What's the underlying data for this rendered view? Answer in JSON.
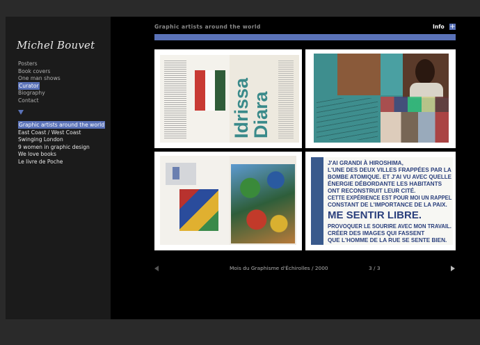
{
  "logo_text": "Michel Bouvet",
  "main_nav": [
    {
      "label": "Posters",
      "selected": false
    },
    {
      "label": "Book covers",
      "selected": false
    },
    {
      "label": "One man shows",
      "selected": false
    },
    {
      "label": "Curator",
      "selected": true
    },
    {
      "label": "Biography",
      "selected": false
    },
    {
      "label": "Contact",
      "selected": false
    }
  ],
  "sub_nav": [
    {
      "label": "Graphic artists around the world",
      "selected": true
    },
    {
      "label": "East Coast / West Coast",
      "selected": false
    },
    {
      "label": "Swinging London",
      "selected": false
    },
    {
      "label": "9 women in graphic design",
      "selected": false
    },
    {
      "label": "We love books",
      "selected": false
    },
    {
      "label": "Le livre de Poche",
      "selected": false
    }
  ],
  "header": {
    "title": "Graphic artists around the world",
    "info_label": "Info",
    "info_icon": "+"
  },
  "thumbnails": {
    "t1_title_line1": "Idrissa",
    "t1_title_line2": "Diara",
    "t4_lines": [
      "J'AI GRANDI À HIROSHIMA,",
      "L'UNE DES DEUX VILLES FRAPPÉES PAR LA",
      "BOMBE ATOMIQUE. ET J'AI VU AVEC QUELLE",
      "ÉNERGIE DÉBORDANTE LES HABITANTS",
      "ONT RECONSTRUIT LEUR CITÉ.",
      "CETTE EXPÉRIENCE EST POUR MOI UN RAPPEL",
      "CONSTANT DE L'IMPORTANCE DE LA PAIX.",
      "ME SENTIR LIBRE.",
      "PROVOQUER LE SOURIRE AVEC MON TRAVAIL.",
      "CRÉER DES IMAGES QUI FASSENT",
      "QUE L'HOMME DE LA RUE SE SENTE BIEN."
    ]
  },
  "footer": {
    "caption": "Mois du Graphisme d'Échirolles / 2000",
    "page_counter": "3 / 3"
  },
  "colors": {
    "accent": "#5a72b8",
    "sidebar_bg": "#1b1b1b",
    "main_bg": "#000000"
  }
}
